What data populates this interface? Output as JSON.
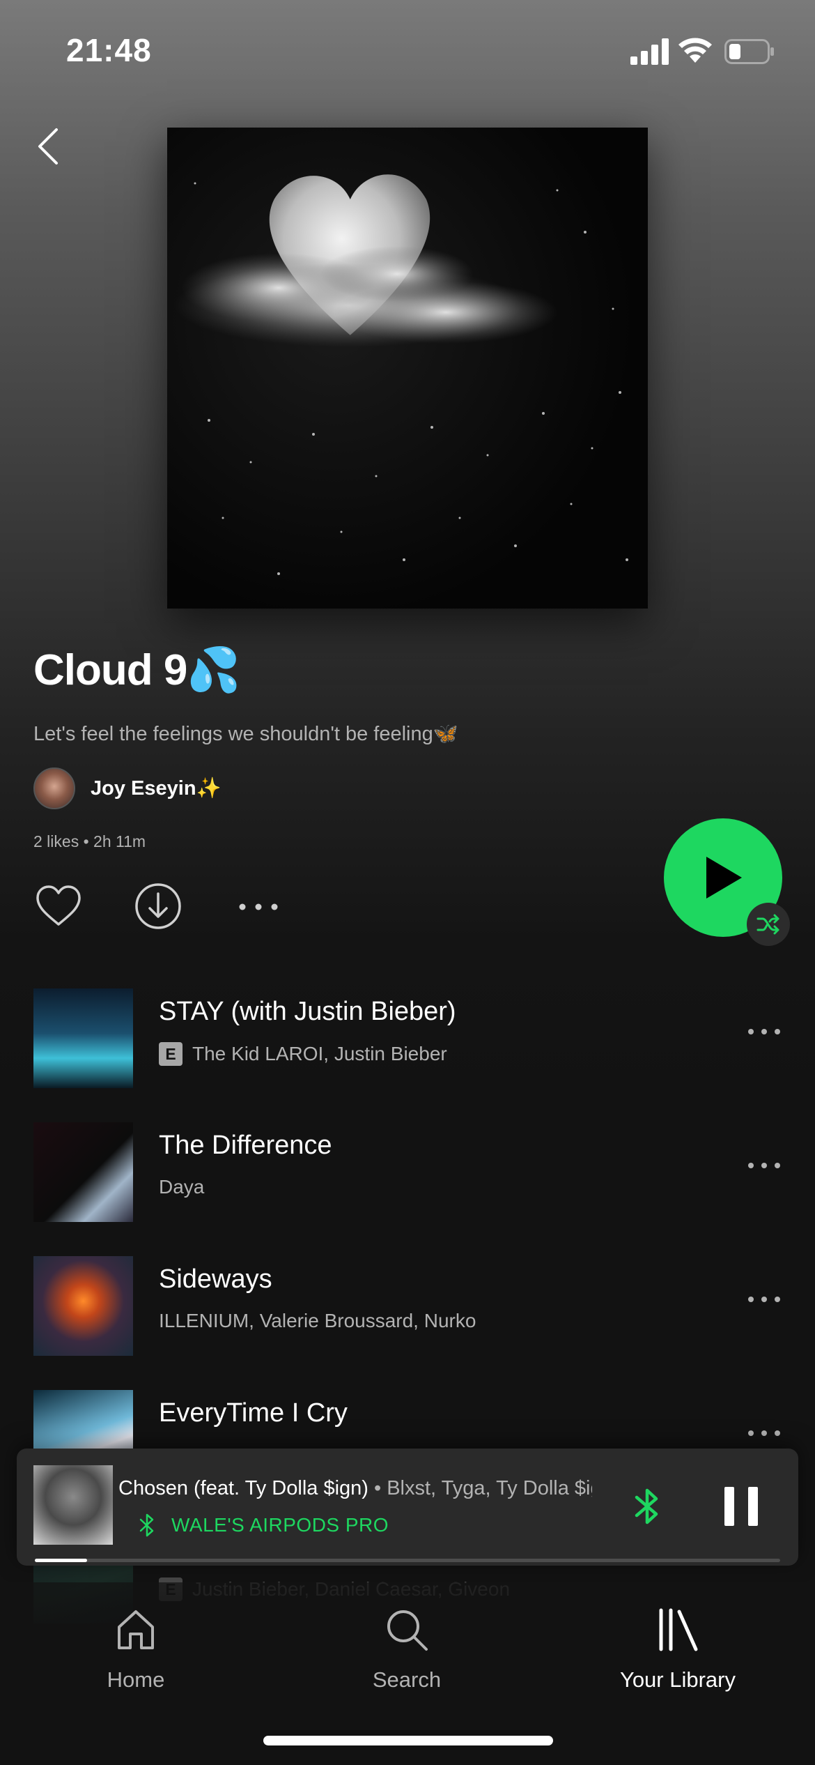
{
  "status_bar": {
    "time": "21:48",
    "icons": [
      "signal-icon",
      "wifi-icon",
      "battery-icon"
    ]
  },
  "header": {
    "back_icon": "chevron-left-icon"
  },
  "playlist": {
    "title": "Cloud 9💦",
    "description": "Let's feel the feelings we shouldn't be feeling🦋",
    "owner": "Joy Eseyin✨",
    "meta": "2 likes • 2h 11m"
  },
  "actions": {
    "like_icon": "heart-icon",
    "download_icon": "download-icon",
    "more_icon": "more-dots-icon",
    "play_icon": "play-icon",
    "shuffle_icon": "shuffle-icon"
  },
  "tracks": [
    {
      "title": "STAY (with Justin Bieber)",
      "artists": "The Kid LAROI, Justin Bieber",
      "explicit": true,
      "explicit_label": "E"
    },
    {
      "title": "The Difference",
      "artists": "Daya",
      "explicit": false
    },
    {
      "title": "Sideways",
      "artists": "ILLENIUM, Valerie Broussard, Nurko",
      "explicit": false
    },
    {
      "title": "EveryTime I Cry",
      "artists": "",
      "explicit": false
    },
    {
      "title": "",
      "artists": "Justin Bieber, Daniel Caesar, Giveon",
      "explicit": true,
      "explicit_label": "E"
    }
  ],
  "now_playing": {
    "title": "Chosen (feat. Ty Dolla $ign)",
    "artists": " • Blxst, Tyga, Ty Dolla $ign",
    "device": "WALE'S AIRPODS PRO",
    "progress": 0.07,
    "bluetooth_icon": "bluetooth-icon",
    "pause_icon": "pause-icon"
  },
  "nav": [
    {
      "label": "Home",
      "icon": "home-icon",
      "active": false
    },
    {
      "label": "Search",
      "icon": "search-icon",
      "active": false
    },
    {
      "label": "Your Library",
      "icon": "library-icon",
      "active": true
    }
  ],
  "colors": {
    "accent": "#1ed760",
    "background": "#121212",
    "secondary_text": "#b3b3b3"
  }
}
